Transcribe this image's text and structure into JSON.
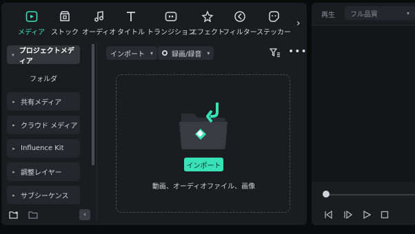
{
  "toolbar": {
    "items": [
      {
        "label": "メディア",
        "icon": "media-icon"
      },
      {
        "label": "ストック",
        "icon": "stock-icon"
      },
      {
        "label": "オーディオ",
        "icon": "audio-icon"
      },
      {
        "label": "タイトル",
        "icon": "title-icon"
      },
      {
        "label": "トランジション",
        "icon": "transition-icon"
      },
      {
        "label": "エフェクト",
        "icon": "effect-icon"
      },
      {
        "label": "フィルター",
        "icon": "filter-icon"
      },
      {
        "label": "ステッカー",
        "icon": "sticker-icon"
      }
    ],
    "next_icon": "›"
  },
  "sidebar": {
    "items": [
      {
        "label": "プロジェクトメディア",
        "expanded": true
      },
      {
        "label": "フォルダ"
      },
      {
        "label": "共有メディア"
      },
      {
        "label": "クラウド メディア"
      },
      {
        "label": "Influence Kit"
      },
      {
        "label": "調整レイヤー"
      },
      {
        "label": "サブシーケンス"
      }
    ],
    "collapse": "‹"
  },
  "content": {
    "import_label": "インポート",
    "record_label": "録画/録音",
    "import_button": "インポート",
    "drop_hint": "動画、オーディオファイル、画像"
  },
  "preview": {
    "play_label": "再生",
    "quality": "フル品質"
  },
  "colors": {
    "accent": "#37e3b6",
    "panel": "#1b1c20"
  }
}
